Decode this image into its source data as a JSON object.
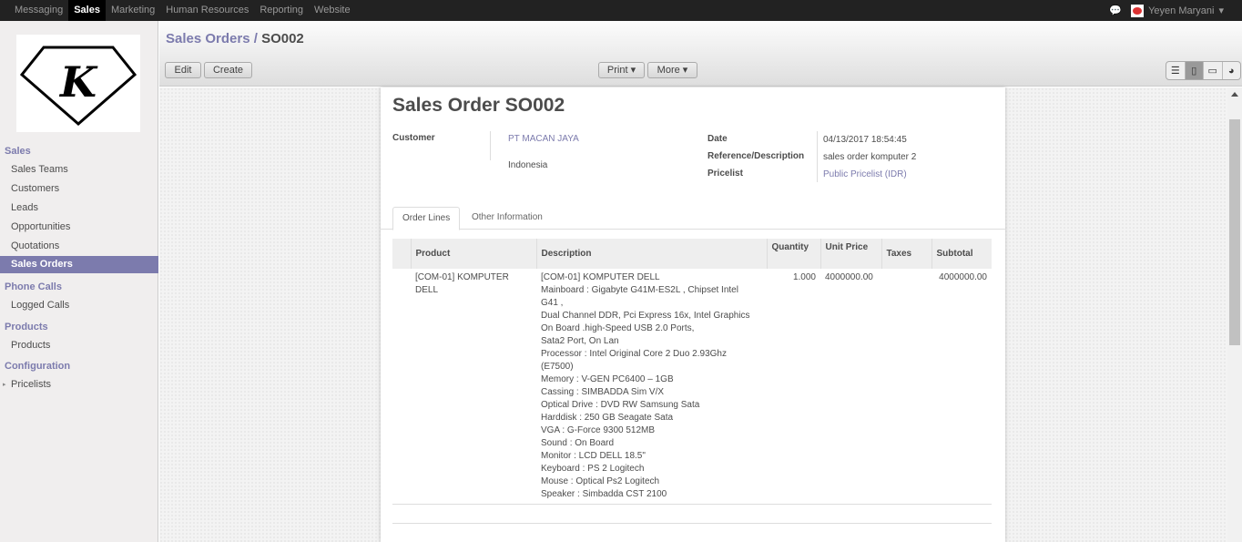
{
  "topbar": {
    "menu": [
      "Messaging",
      "Sales",
      "Marketing",
      "Human Resources",
      "Reporting",
      "Website"
    ],
    "active": "Sales",
    "user": "Yeyen Maryani"
  },
  "sidebar": {
    "sections": [
      {
        "title": "Sales",
        "items": [
          "Sales Teams",
          "Customers",
          "Leads",
          "Opportunities",
          "Quotations",
          "Sales Orders"
        ]
      },
      {
        "title": "Phone Calls",
        "items": [
          "Logged Calls"
        ]
      },
      {
        "title": "Products",
        "items": [
          "Products"
        ]
      },
      {
        "title": "Configuration",
        "items": [
          "Pricelists"
        ]
      }
    ],
    "active": "Sales Orders"
  },
  "breadcrumb": {
    "parent": "Sales Orders",
    "sep": " / ",
    "current": "SO002"
  },
  "toolbar": {
    "edit": "Edit",
    "create": "Create",
    "print": "Print ▾",
    "more": "More ▾"
  },
  "form": {
    "title": "Sales Order",
    "number": "SO002",
    "customer_label": "Customer",
    "customer": "PT MACAN JAYA",
    "customer_country": "Indonesia",
    "date_label": "Date",
    "date": "04/13/2017 18:54:45",
    "ref_label": "Reference/Description",
    "ref": "sales order komputer 2",
    "pricelist_label": "Pricelist",
    "pricelist": "Public Pricelist (IDR)"
  },
  "tabs": [
    "Order Lines",
    "Other Information"
  ],
  "table": {
    "headers": [
      "Product",
      "Description",
      "Quantity",
      "Unit Price",
      "Taxes",
      "Subtotal"
    ],
    "rows": [
      {
        "product": "[COM-01] KOMPUTER DELL",
        "qty": "1.000",
        "price": "4000000.00",
        "taxes": "",
        "subtotal": "4000000.00",
        "description": [
          "[COM-01] KOMPUTER DELL",
          "Mainboard : Gigabyte G41M-ES2L , Chipset Intel",
          "G41 ,",
          "Dual Channel DDR, Pci Express 16x, Intel Graphics",
          "On Board .high-Speed USB 2.0 Ports,",
          "Sata2 Port, On Lan",
          "Processor : Intel Original Core 2 Duo 2.93Ghz",
          "(E7500)",
          "Memory : V-GEN PC6400 – 1GB",
          "Cassing : SIMBADDA Sim V/X",
          "Optical Drive : DVD RW Samsung Sata",
          "Harddisk : 250 GB Seagate Sata",
          "VGA : G-Force 9300 512MB",
          "Sound : On Board",
          "Monitor : LCD DELL 18.5\"",
          "Keyboard : PS 2 Logitech",
          "Mouse : Optical Ps2 Logitech",
          "Speaker : Simbadda CST 2100"
        ]
      }
    ]
  }
}
